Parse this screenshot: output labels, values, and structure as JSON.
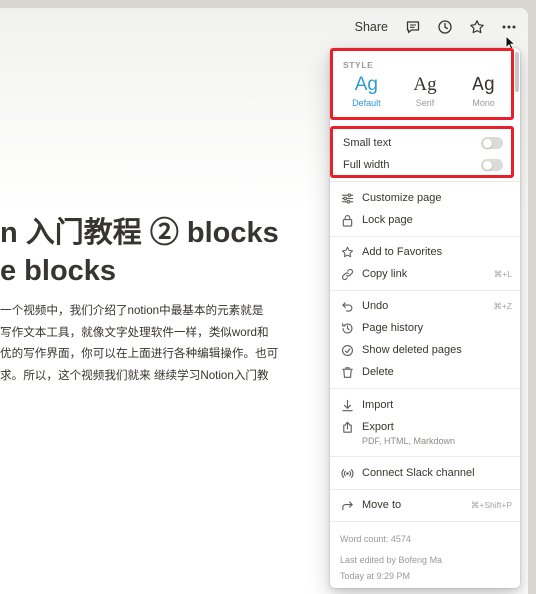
{
  "topbar": {
    "share_label": "Share",
    "icons": [
      "comment-icon",
      "clock-icon",
      "star-icon",
      "more-icon"
    ]
  },
  "document": {
    "title_lines": [
      "n 入门教程 ② blocks",
      "e blocks"
    ],
    "body_lines": [
      "一个视频中，我们介绍了notion中最基本的元素就是",
      "写作文本工具，就像文字处理软件一样，类似word和",
      "优的写作界面，你可以在上面进行各种编辑操作。也可",
      "求。所以，这个视频我们就来 继续学习Notion入门教"
    ]
  },
  "menu": {
    "style": {
      "header": "STYLE",
      "options": [
        {
          "glyph": "Ag",
          "label": "Default",
          "active": true
        },
        {
          "glyph": "Ag",
          "label": "Serif",
          "active": false
        },
        {
          "glyph": "Ag",
          "label": "Mono",
          "active": false
        }
      ]
    },
    "toggles": [
      {
        "label": "Small text",
        "on": false
      },
      {
        "label": "Full width",
        "on": false
      }
    ],
    "items": [
      {
        "icon": "sliders-icon",
        "label": "Customize page",
        "shortcut": ""
      },
      {
        "icon": "lock-icon",
        "label": "Lock page",
        "shortcut": ""
      },
      {
        "icon": "star-icon",
        "label": "Add to Favorites",
        "shortcut": ""
      },
      {
        "icon": "link-icon",
        "label": "Copy link",
        "shortcut": "⌘+L"
      },
      {
        "icon": "undo-icon",
        "label": "Undo",
        "shortcut": "⌘+Z"
      },
      {
        "icon": "history-icon",
        "label": "Page history",
        "shortcut": ""
      },
      {
        "icon": "trash-restore-icon",
        "label": "Show deleted pages",
        "shortcut": ""
      },
      {
        "icon": "trash-icon",
        "label": "Delete",
        "shortcut": ""
      },
      {
        "icon": "import-icon",
        "label": "Import",
        "shortcut": ""
      },
      {
        "icon": "export-icon",
        "label": "Export",
        "shortcut": "",
        "sublabel": "PDF, HTML, Markdown"
      },
      {
        "icon": "slack-icon",
        "label": "Connect Slack channel",
        "shortcut": ""
      },
      {
        "icon": "move-icon",
        "label": "Move to",
        "shortcut": "⌘+Shift+P"
      }
    ],
    "meta": {
      "word_count": "Word count: 4574",
      "last_edited_by": "Last edited by Bofeng Ma",
      "last_edited_time": "Today at 9:29 PM"
    }
  },
  "colors": {
    "accent": "#2e9ad0",
    "highlight_border": "#e8202a",
    "text": "#37352f",
    "muted": "#9b9a97"
  }
}
